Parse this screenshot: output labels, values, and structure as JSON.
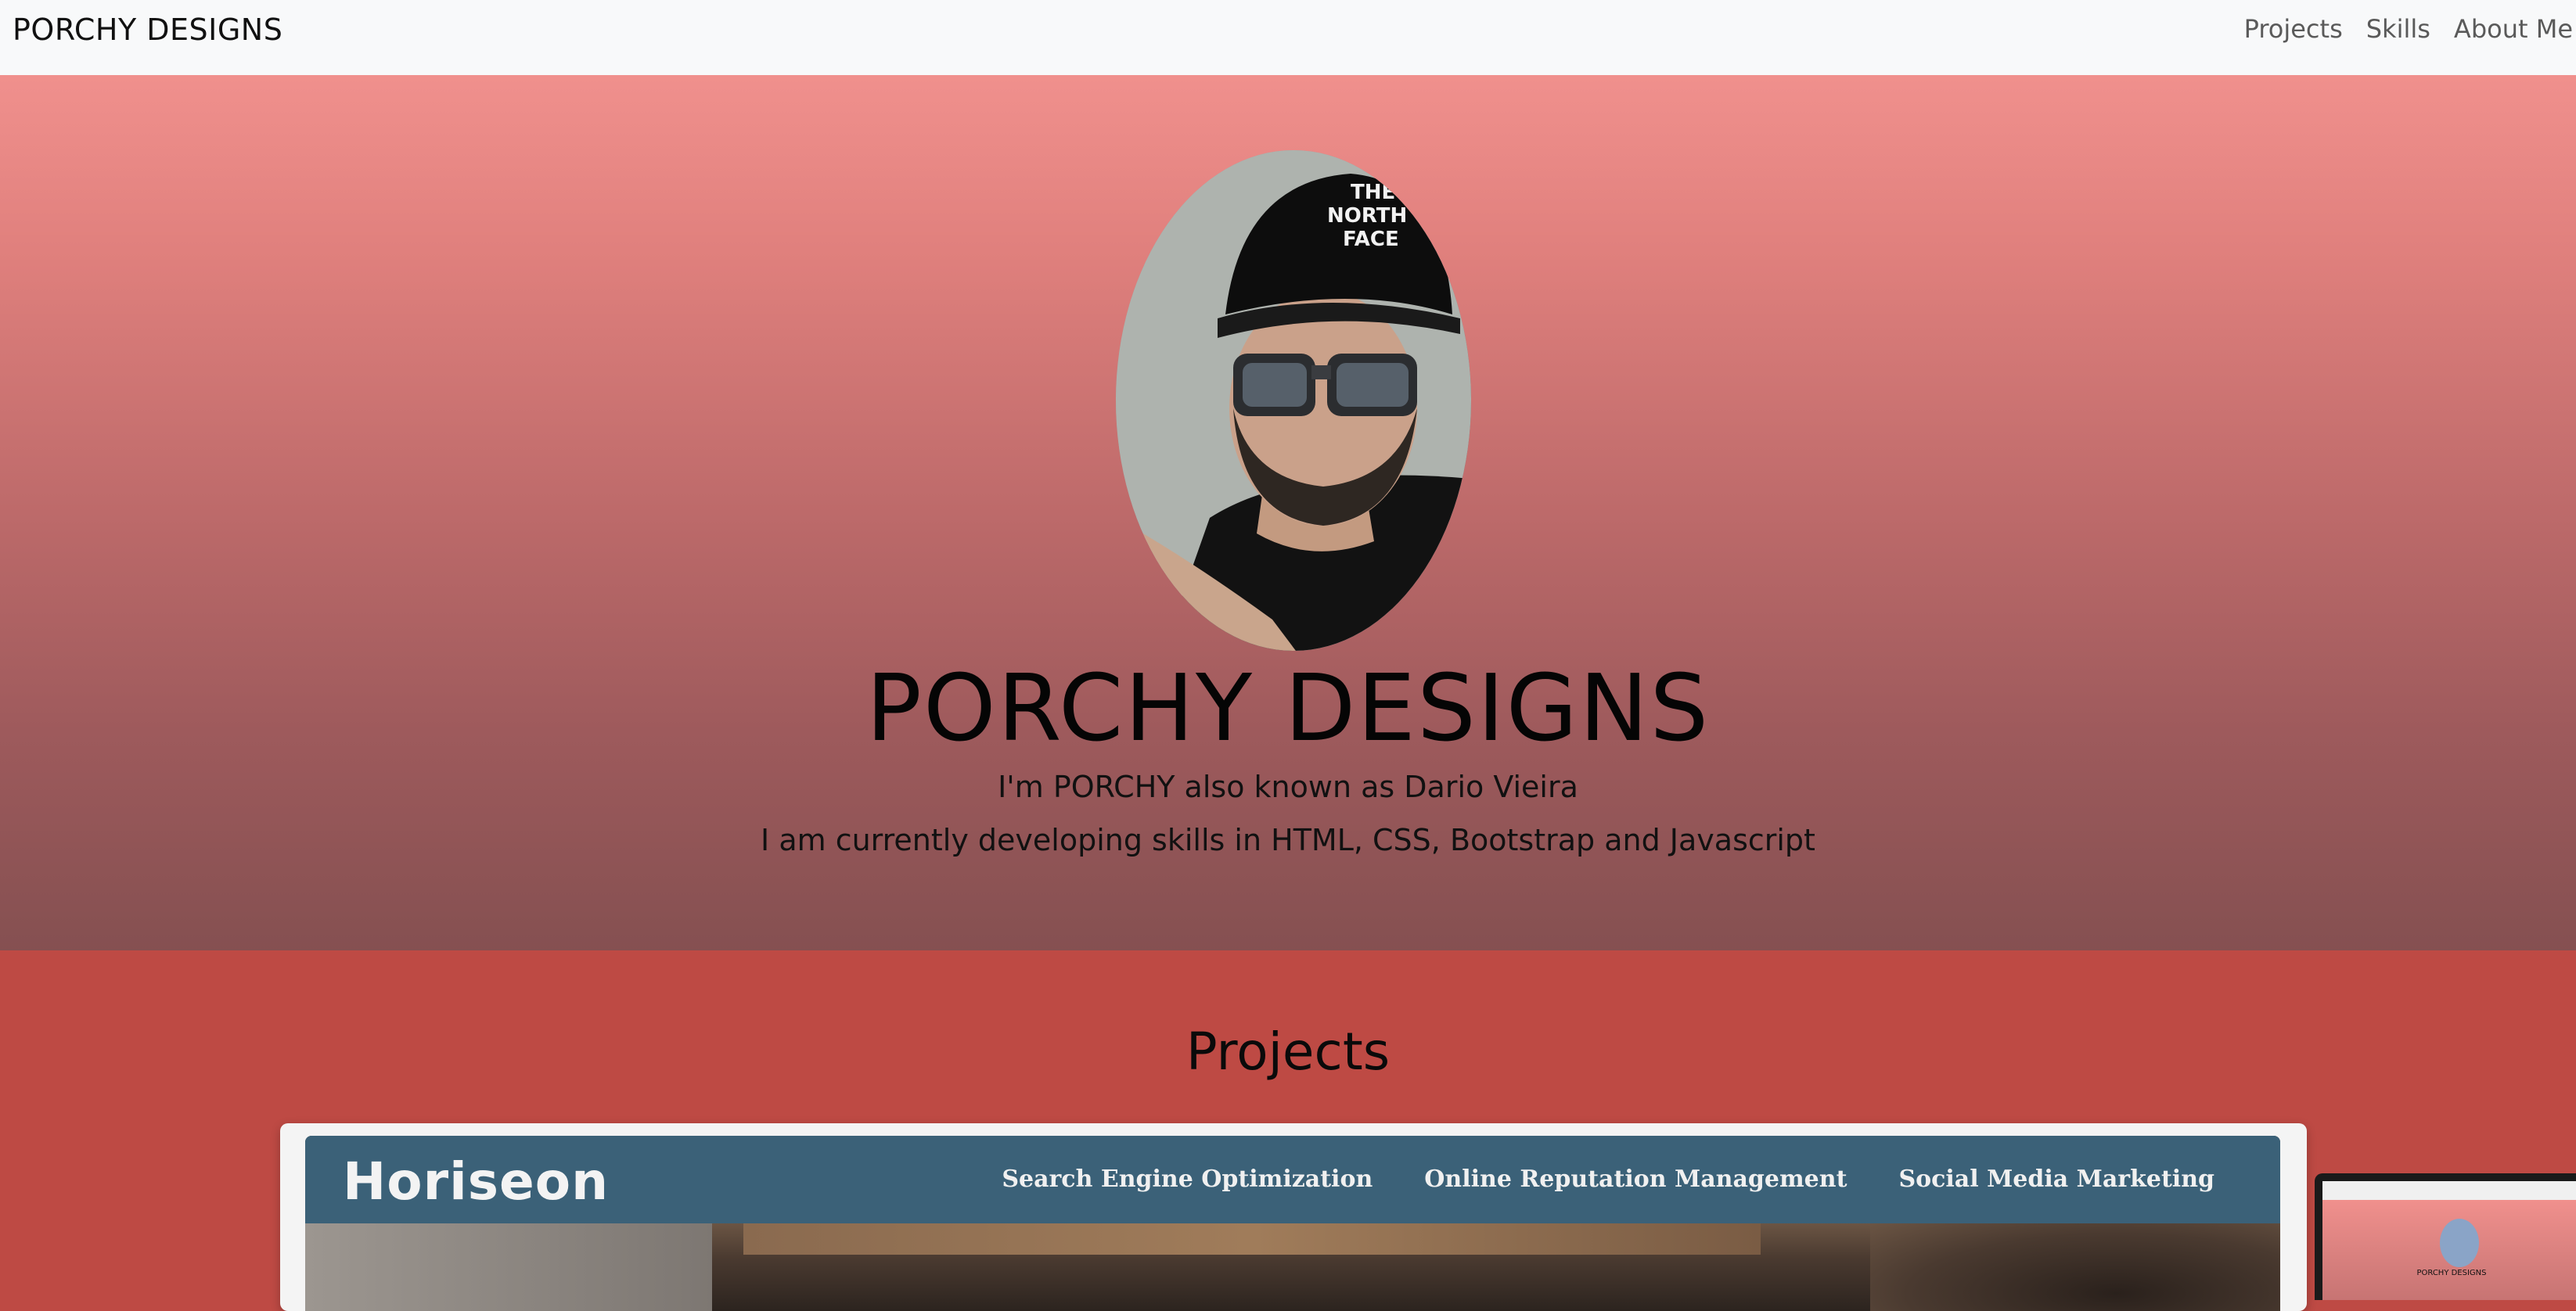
{
  "navbar": {
    "brand": "PORCHY DESIGNS",
    "links": [
      "Projects",
      "Skills",
      "About Me"
    ]
  },
  "hero": {
    "title": "PORCHY DESIGNS",
    "line1": "I'm PORCHY also known as Dario Vieira",
    "line2": "I am currently developing skills in HTML, CSS, Bootstrap and Javascript",
    "cap_logo_text": [
      "THE",
      "NORTH",
      "FACE"
    ]
  },
  "projects": {
    "heading": "Projects",
    "current": {
      "logo": "Horiseon",
      "nav": [
        "Search Engine Optimization",
        "Online Reputation Management",
        "Social Media Marketing"
      ]
    },
    "next_preview": {
      "title": "PORCHY DESIGNS"
    }
  },
  "colors": {
    "navbar_bg": "#f8f9fa",
    "hero_gradient_top": "#f0908d",
    "hero_gradient_bottom": "#855051",
    "projects_bg": "#be4a44",
    "horiseon_header": "#3b6178"
  }
}
